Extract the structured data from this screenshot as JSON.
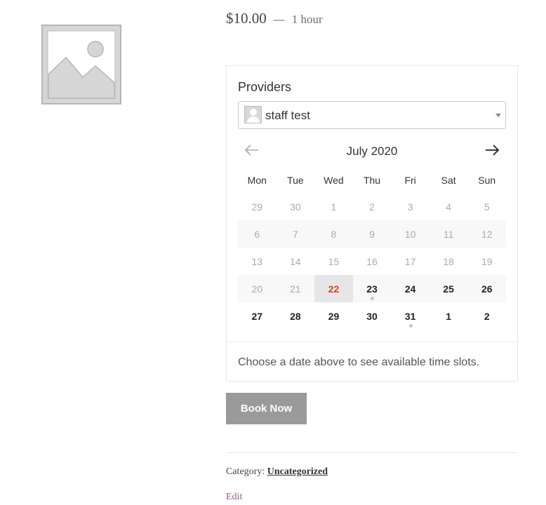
{
  "product": {
    "price": "$10.00",
    "separator": "—",
    "duration": "1 hour",
    "image_icon": "image-placeholder-icon"
  },
  "booking": {
    "providers_label": "Providers",
    "provider_selected": "staff test",
    "month_label": "July 2020",
    "prev_icon": "arrow-left-icon",
    "next_icon": "arrow-right-icon",
    "weekdays": [
      "Mon",
      "Tue",
      "Wed",
      "Thu",
      "Fri",
      "Sat",
      "Sun"
    ],
    "weeks": [
      [
        {
          "d": "29",
          "s": "muted"
        },
        {
          "d": "30",
          "s": "muted"
        },
        {
          "d": "1",
          "s": "muted"
        },
        {
          "d": "2",
          "s": "muted"
        },
        {
          "d": "3",
          "s": "muted"
        },
        {
          "d": "4",
          "s": "muted"
        },
        {
          "d": "5",
          "s": "muted"
        }
      ],
      [
        {
          "d": "6",
          "s": "muted"
        },
        {
          "d": "7",
          "s": "muted"
        },
        {
          "d": "8",
          "s": "muted"
        },
        {
          "d": "9",
          "s": "muted"
        },
        {
          "d": "10",
          "s": "muted"
        },
        {
          "d": "11",
          "s": "muted"
        },
        {
          "d": "12",
          "s": "muted"
        }
      ],
      [
        {
          "d": "13",
          "s": "muted"
        },
        {
          "d": "14",
          "s": "muted"
        },
        {
          "d": "15",
          "s": "muted"
        },
        {
          "d": "16",
          "s": "muted"
        },
        {
          "d": "17",
          "s": "muted"
        },
        {
          "d": "18",
          "s": "muted"
        },
        {
          "d": "19",
          "s": "muted"
        }
      ],
      [
        {
          "d": "20",
          "s": "muted"
        },
        {
          "d": "21",
          "s": "muted"
        },
        {
          "d": "22",
          "s": "today"
        },
        {
          "d": "23",
          "s": "bookable",
          "dot": true
        },
        {
          "d": "24",
          "s": "bookable"
        },
        {
          "d": "25",
          "s": "bookable"
        },
        {
          "d": "26",
          "s": "bookable"
        }
      ],
      [
        {
          "d": "27",
          "s": "bookable"
        },
        {
          "d": "28",
          "s": "bookable"
        },
        {
          "d": "29",
          "s": "bookable"
        },
        {
          "d": "30",
          "s": "bookable"
        },
        {
          "d": "31",
          "s": "bookable",
          "dot": true
        },
        {
          "d": "1",
          "s": "bookable"
        },
        {
          "d": "2",
          "s": "bookable"
        }
      ]
    ],
    "timeslot_message": "Choose a date above to see available time slots.",
    "book_button": "Book Now"
  },
  "meta": {
    "category_label": "Category:",
    "category_value": "Uncategorized",
    "edit_link": "Edit"
  },
  "colors": {
    "today": "#e2401c",
    "button_bg": "#9a9a9a",
    "edit_link": "#96588a"
  }
}
